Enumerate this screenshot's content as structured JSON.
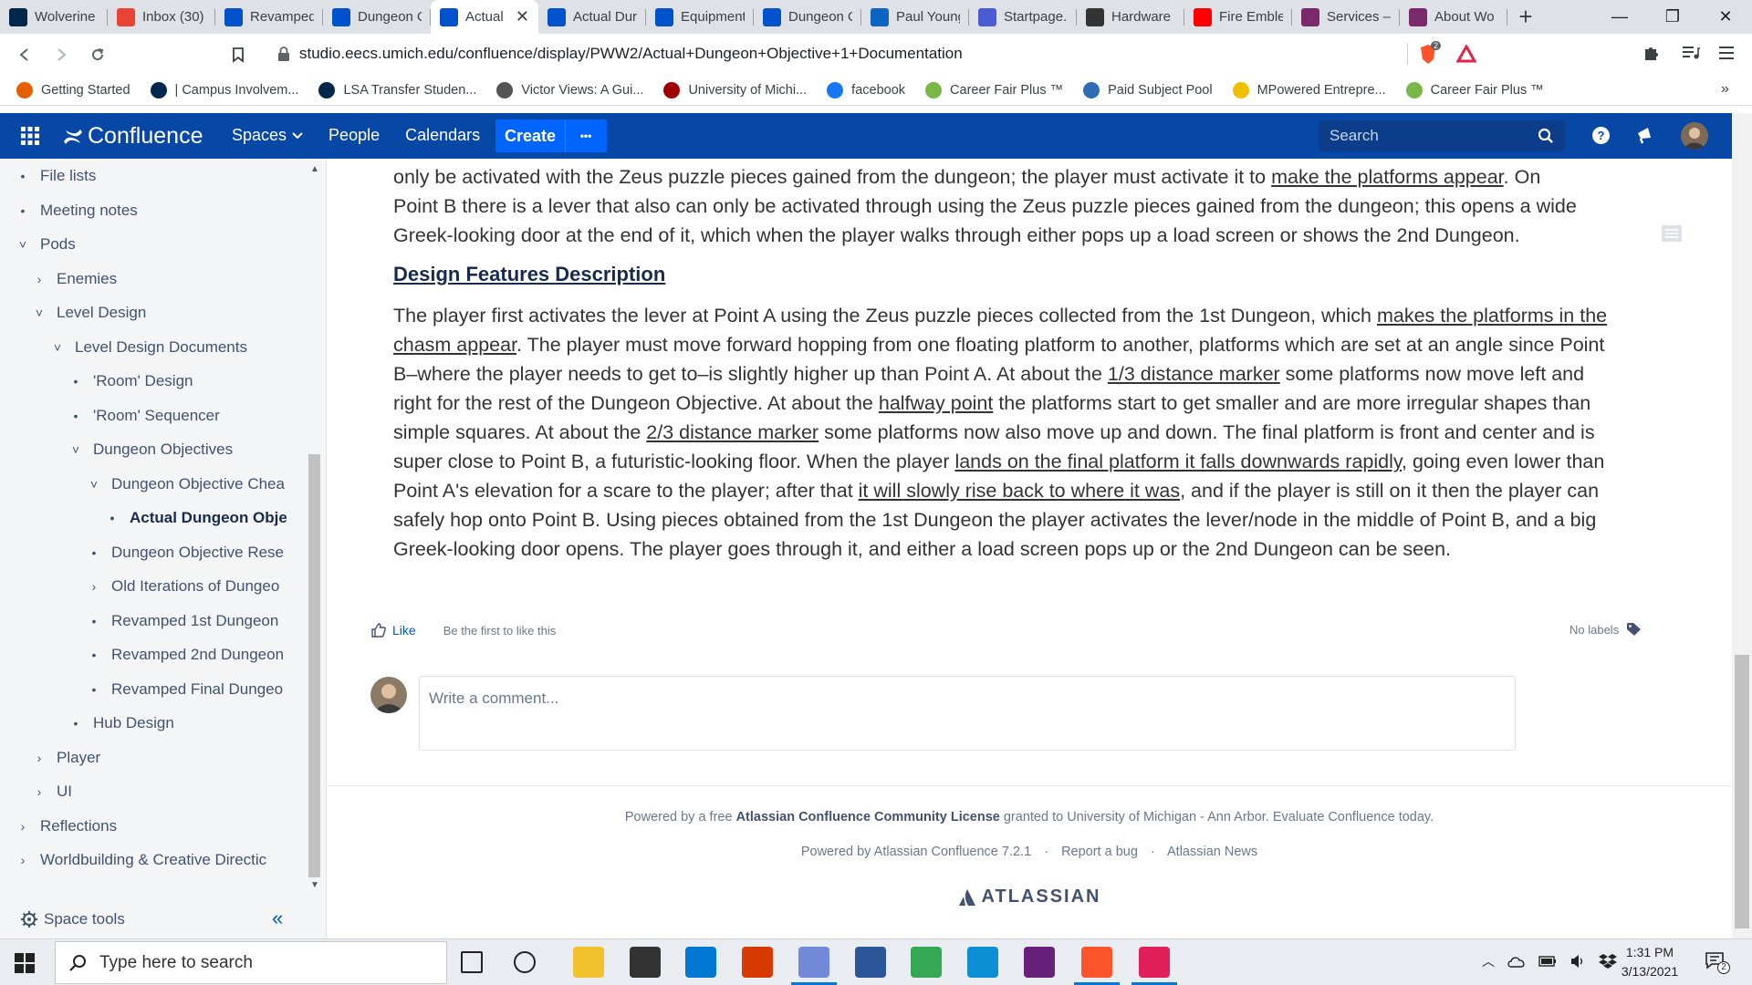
{
  "browser": {
    "tabs": [
      {
        "title": "Wolverine",
        "icon": "michigan-m-icon",
        "color": "#00274c"
      },
      {
        "title": "Inbox (30)",
        "icon": "gmail-icon",
        "color": "#ea4335"
      },
      {
        "title": "Revamped",
        "icon": "confluence-icon",
        "color": "#0052cc"
      },
      {
        "title": "Dungeon O",
        "icon": "confluence-icon",
        "color": "#0052cc"
      },
      {
        "title": "Actual",
        "icon": "confluence-icon",
        "color": "#0052cc",
        "active": true
      },
      {
        "title": "Actual Dur",
        "icon": "confluence-icon",
        "color": "#0052cc"
      },
      {
        "title": "Equipment",
        "icon": "confluence-icon",
        "color": "#0052cc"
      },
      {
        "title": "Dungeon O",
        "icon": "confluence-icon",
        "color": "#0052cc"
      },
      {
        "title": "Paul Young",
        "icon": "linkedin-icon",
        "color": "#0a66c2"
      },
      {
        "title": "Startpage.c",
        "icon": "startpage-icon",
        "color": "#4a5bd4"
      },
      {
        "title": "Hardware",
        "icon": "hardware-icon",
        "color": "#333333"
      },
      {
        "title": "Fire Emble",
        "icon": "youtube-icon",
        "color": "#ff0000"
      },
      {
        "title": "Services —",
        "icon": "services-icon",
        "color": "#7a2a6a"
      },
      {
        "title": "About Wo",
        "icon": "about-icon",
        "color": "#7a2a6a"
      }
    ],
    "url": "studio.eecs.umich.edu/confluence/display/PWW2/Actual+Dungeon+Objective+1+Documentation",
    "brave_badge": "2",
    "bookmarks": [
      {
        "label": "Getting Started",
        "icon": "firefox-icon",
        "color": "#e66000"
      },
      {
        "label": "| Campus Involvem...",
        "icon": "michigan-m-icon",
        "color": "#00274c"
      },
      {
        "label": "LSA Transfer Studen...",
        "icon": "lsa-icon",
        "color": "#00274c"
      },
      {
        "label": "Victor Views: A Gui...",
        "icon": "globe-icon",
        "color": "#555555"
      },
      {
        "label": "University of Michi...",
        "icon": "umich-icon",
        "color": "#a00000"
      },
      {
        "label": "facebook",
        "icon": "facebook-icon",
        "color": "#1877f2"
      },
      {
        "label": "Career Fair Plus ™",
        "icon": "cf-icon",
        "color": "#7ab648"
      },
      {
        "label": "Paid Subject Pool",
        "icon": "pool-icon",
        "color": "#2f6db5"
      },
      {
        "label": "MPowered Entrepre...",
        "icon": "hex-icon",
        "color": "#f0c000"
      },
      {
        "label": "Career Fair Plus ™",
        "icon": "cf-icon",
        "color": "#7ab648"
      }
    ]
  },
  "confluence": {
    "logo": "Confluence",
    "nav": {
      "spaces": "Spaces",
      "people": "People",
      "calendars": "Calendars",
      "create": "Create",
      "more": "•••"
    },
    "search_placeholder": "Search"
  },
  "sidebar": {
    "items": [
      {
        "label": "File lists",
        "marker": "•"
      },
      {
        "label": "Meeting notes",
        "marker": "•"
      },
      {
        "label": "Pods",
        "marker": "˅"
      },
      {
        "label": "Enemies",
        "marker": "›"
      },
      {
        "label": "Level Design",
        "marker": "˅"
      },
      {
        "label": "Level Design Documents",
        "marker": "˅"
      },
      {
        "label": "'Room' Design",
        "marker": "•"
      },
      {
        "label": "'Room' Sequencer",
        "marker": "•"
      },
      {
        "label": "Dungeon Objectives",
        "marker": "˅"
      },
      {
        "label": "Dungeon Objective Chea",
        "marker": "˅"
      },
      {
        "label": "Actual Dungeon Obje",
        "marker": "•",
        "current": true
      },
      {
        "label": "Dungeon Objective Rese",
        "marker": "•"
      },
      {
        "label": "Old Iterations of Dungeo",
        "marker": "›"
      },
      {
        "label": "Revamped 1st Dungeon",
        "marker": "•"
      },
      {
        "label": "Revamped 2nd Dungeon",
        "marker": "•"
      },
      {
        "label": "Revamped Final Dungeo",
        "marker": "•"
      },
      {
        "label": "Hub Design",
        "marker": "•"
      },
      {
        "label": "Player",
        "marker": "›"
      },
      {
        "label": "UI",
        "marker": "›"
      },
      {
        "label": "Reflections",
        "marker": "›"
      },
      {
        "label": "Worldbuilding & Creative Directic",
        "marker": "›"
      }
    ],
    "space_tools": "Space tools",
    "collapse": "«"
  },
  "content": {
    "intro_p1": "only be activated with the Zeus puzzle pieces gained from the dungeon; the player must activate it to ",
    "intro_link": "make the platforms appear",
    "intro_p2": ". On",
    "intro_line2": "Point B there is a lever that also can only be activated through using the Zeus puzzle pieces gained from the dungeon; this opens a wide",
    "intro_line3": "Greek-looking door at the end of it, which when the player walks through either pops up a load screen or shows the 2nd Dungeon.",
    "heading": "Design Features Description",
    "body": [
      {
        "t": "The player first activates the lever at Point A using the Zeus puzzle pieces collected from the 1st Dungeon, which "
      },
      {
        "t": "makes the platforms in the chasm appear",
        "u": true
      },
      {
        "t": ". The player must move forward hopping from one floating platform to another, platforms which are set at an angle since Point B–where the player needs to get to–is slightly higher up than Point A. At about the "
      },
      {
        "t": "1/3 distance marker",
        "u": true
      },
      {
        "t": " some platforms now move left and right for the rest of the Dungeon Objective. At about the "
      },
      {
        "t": "halfway point",
        "u": true
      },
      {
        "t": " the platforms start to get smaller and are more irregular shapes than simple squares. At about the "
      },
      {
        "t": "2/3 distance marker",
        "u": true
      },
      {
        "t": " some platforms now also move up and down. The final platform is front and center and is super close to Point B, a futuristic-looking floor. When the player "
      },
      {
        "t": "lands on the final platform it falls downwards rapidly",
        "u": true
      },
      {
        "t": ", going even lower than Point A's elevation for a scare to the player; after that "
      },
      {
        "t": "it will slowly rise back to where it was",
        "u": true
      },
      {
        "t": ", and if the player is still on it then the player can safely hop onto Point B. Using pieces obtained from the 1st Dungeon the player activates the lever/node in the middle of Point B, and a big Greek-looking door opens. The player goes through it, and either a load screen pops up or the 2nd Dungeon can be seen."
      }
    ],
    "like": "Like",
    "like_hint": "Be the first to like this",
    "labels": "No labels",
    "comment_placeholder": "Write a comment..."
  },
  "footer": {
    "license_pre": "Powered by a free ",
    "license_bold": "Atlassian Confluence Community License",
    "license_post": " granted to University of Michigan - Ann Arbor. Evaluate Confluence today.",
    "powered": "Powered by Atlassian Confluence 7.2.1",
    "report": "Report a bug",
    "news": "Atlassian News",
    "brand": "ATLASSIAN"
  },
  "taskbar": {
    "search_placeholder": "Type here to search",
    "time": "1:31 PM",
    "date": "3/13/2021",
    "notif_count": "2"
  }
}
